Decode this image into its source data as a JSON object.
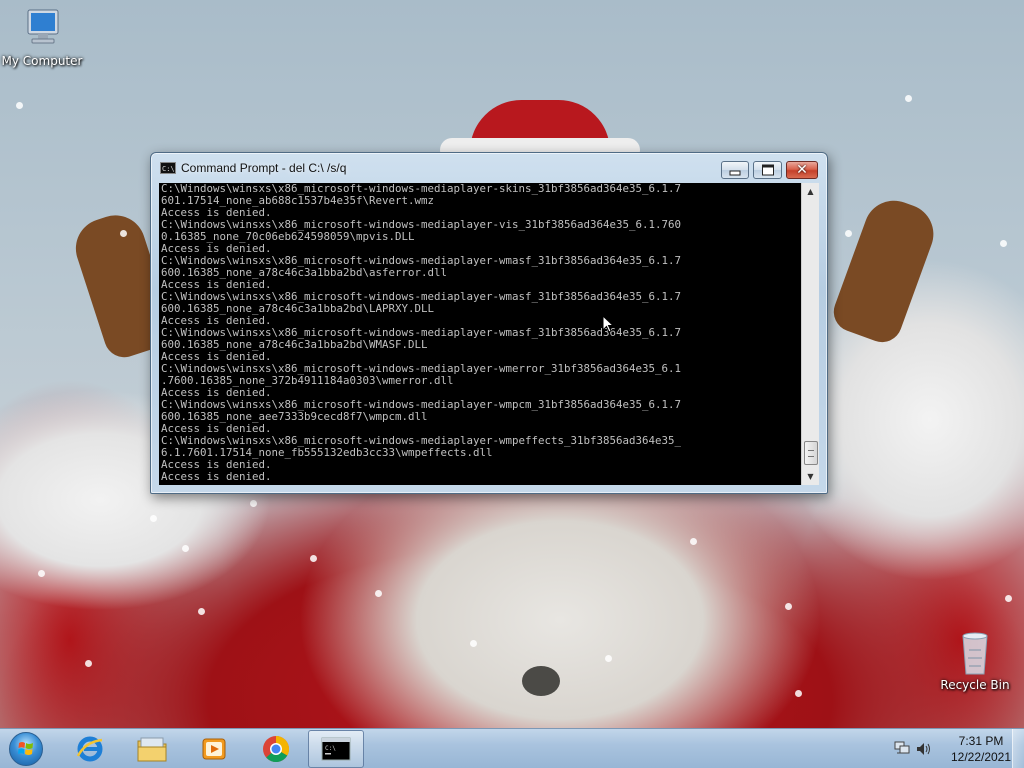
{
  "desktop": {
    "icons": [
      {
        "label": "My Computer",
        "icon": "computer-icon"
      },
      {
        "label": "Recycle Bin",
        "icon": "recycle-bin-icon"
      }
    ],
    "wallpaper": "santa-claus-snow"
  },
  "cmd_window": {
    "title": "Command Prompt - del  C:\\ /s/q",
    "console_lines": [
      "C:\\Windows\\winsxs\\x86_microsoft-windows-mediaplayer-skins_31bf3856ad364e35_6.1.7",
      "601.17514_none_ab688c1537b4e35f\\Revert.wmz",
      "Access is denied.",
      "C:\\Windows\\winsxs\\x86_microsoft-windows-mediaplayer-vis_31bf3856ad364e35_6.1.760",
      "0.16385_none_70c06eb624598059\\mpvis.DLL",
      "Access is denied.",
      "C:\\Windows\\winsxs\\x86_microsoft-windows-mediaplayer-wmasf_31bf3856ad364e35_6.1.7",
      "600.16385_none_a78c46c3a1bba2bd\\asferror.dll",
      "Access is denied.",
      "C:\\Windows\\winsxs\\x86_microsoft-windows-mediaplayer-wmasf_31bf3856ad364e35_6.1.7",
      "600.16385_none_a78c46c3a1bba2bd\\LAPRXY.DLL",
      "Access is denied.",
      "C:\\Windows\\winsxs\\x86_microsoft-windows-mediaplayer-wmasf_31bf3856ad364e35_6.1.7",
      "600.16385_none_a78c46c3a1bba2bd\\WMASF.DLL",
      "Access is denied.",
      "C:\\Windows\\winsxs\\x86_microsoft-windows-mediaplayer-wmerror_31bf3856ad364e35_6.1",
      ".7600.16385_none_372b4911184a0303\\wmerror.dll",
      "Access is denied.",
      "C:\\Windows\\winsxs\\x86_microsoft-windows-mediaplayer-wmpcm_31bf3856ad364e35_6.1.7",
      "600.16385_none_aee7333b9cecd8f7\\wmpcm.dll",
      "Access is denied.",
      "C:\\Windows\\winsxs\\x86_microsoft-windows-mediaplayer-wmpeffects_31bf3856ad364e35_",
      "6.1.7601.17514_none_fb555132edb3cc33\\wmpeffects.dll",
      "Access is denied.",
      "Access is denied."
    ],
    "buttons": {
      "minimize": "minimize-icon",
      "maximize": "maximize-icon",
      "close": "close-icon"
    }
  },
  "taskbar": {
    "start": "windows-start-icon",
    "pinned": [
      {
        "name": "internet-explorer-icon"
      },
      {
        "name": "file-explorer-icon"
      },
      {
        "name": "media-player-icon"
      },
      {
        "name": "chrome-icon"
      },
      {
        "name": "command-prompt-icon",
        "active": true
      }
    ],
    "tray": {
      "network": "network-icon",
      "volume": "volume-icon",
      "time": "7:31 PM",
      "date": "12/22/2021"
    }
  }
}
